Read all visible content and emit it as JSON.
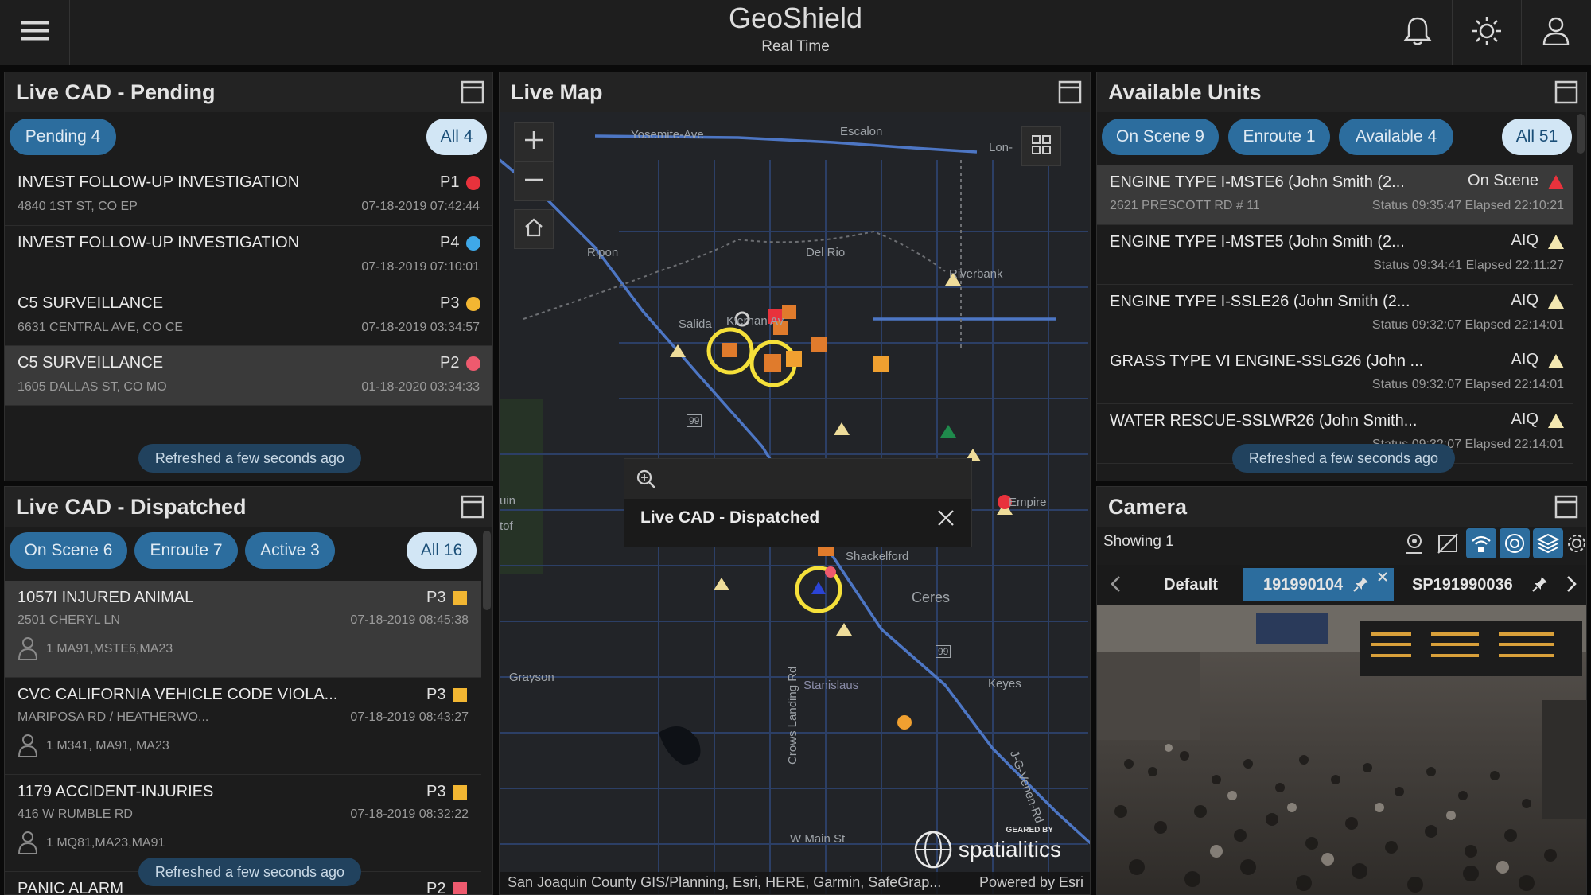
{
  "app": {
    "title": "GeoShield",
    "subtitle": "Real Time"
  },
  "icons": {
    "menu": "hamburger-menu-icon",
    "notifications": "bell-icon",
    "theme": "sun-icon",
    "user": "user-icon",
    "maximize": "window-maximize-icon"
  },
  "colors": {
    "accent": "#2c6d9e",
    "p1": "#e8323c",
    "p4": "#3fa8e8",
    "p3": "#f2b632",
    "p2": "#ee5a6e"
  },
  "pending": {
    "title": "Live CAD - Pending",
    "chips": [
      {
        "label": "Pending 4"
      }
    ],
    "all_label": "All 4",
    "rows": [
      {
        "title": "INVEST FOLLOW-UP INVESTIGATION",
        "address": "4840 1ST ST, CO EP",
        "priority": "P1",
        "datetime": "07-18-2019 07:42:44"
      },
      {
        "title": "INVEST FOLLOW-UP INVESTIGATION",
        "address": "",
        "priority": "P4",
        "datetime": "07-18-2019 07:10:01"
      },
      {
        "title": "C5 SURVEILLANCE",
        "address": "6631 CENTRAL AVE, CO CE",
        "priority": "P3",
        "datetime": "07-18-2019 03:34:57"
      },
      {
        "title": "C5 SURVEILLANCE",
        "address": "1605 DALLAS ST, CO MO",
        "priority": "P2",
        "datetime": "01-18-2020 03:34:33"
      }
    ],
    "refresh": "Refreshed a few seconds ago"
  },
  "dispatched": {
    "title": "Live CAD - Dispatched",
    "chips": [
      {
        "label": "On Scene 6"
      },
      {
        "label": "Enroute 7"
      },
      {
        "label": "Active 3"
      }
    ],
    "all_label": "All 16",
    "rows": [
      {
        "title": "1057I INJURED ANIMAL",
        "address": "2501 CHERYL LN",
        "priority": "P3",
        "datetime": "07-18-2019 08:45:38",
        "units": "1 MA91,MSTE6,MA23"
      },
      {
        "title": "CVC CALIFORNIA VEHICLE CODE VIOLA...",
        "address": "MARIPOSA RD / HEATHERWO...",
        "priority": "P3",
        "datetime": "07-18-2019 08:43:27",
        "units": "1 M341, MA91, MA23"
      },
      {
        "title": "1179 ACCIDENT-INJURIES",
        "address": "416 W RUMBLE RD",
        "priority": "P3",
        "datetime": "07-18-2019 08:32:22",
        "units": "1 MQ81,MA23,MA91"
      },
      {
        "title": "PANIC ALARM",
        "address": "",
        "priority": "P2",
        "datetime": "",
        "units": ""
      }
    ],
    "refresh": "Refreshed a few seconds ago"
  },
  "map": {
    "title": "Live Map",
    "labels": {
      "yosemite": "Yosemite-Ave",
      "escalon": "Escalon",
      "lon": "Lon-",
      "ripon": "Ripon",
      "delrio": "Del Rio",
      "riverbank": "Riverbank",
      "salida": "Salida",
      "kiernan": "Kiernan Av",
      "empire": "Empire",
      "shackelford": "Shackelford",
      "ceres": "Ceres",
      "grayson": "Grayson",
      "stanislaus": "Stanislaus",
      "keyes": "Keyes",
      "crows": "Crows Landing Rd",
      "wmain": "W Main St",
      "jgv": "J-G-Venen-Rd",
      "hwy99a": "99",
      "hwy99b": "99",
      "tuin": "uin",
      "tof": "tof"
    },
    "popup_title": "Live CAD - Dispatched",
    "attribution": "San Joaquin County GIS/Planning, Esri, HERE, Garmin, SafeGrap...",
    "powered": "Powered by Esri",
    "brand_geared": "GEARED BY",
    "brand_name": "spatialitics"
  },
  "units": {
    "title": "Available Units",
    "chips": [
      {
        "label": "On Scene 9"
      },
      {
        "label": "Enroute 1"
      },
      {
        "label": "Available 4"
      }
    ],
    "all_label": "All 51",
    "rows": [
      {
        "name": "ENGINE TYPE I-MSTE6 (John Smith (2...",
        "status": "On Scene",
        "address": "2621 PRESCOTT RD # 11",
        "times": "Status 09:35:47 Elapsed 22:10:21"
      },
      {
        "name": "ENGINE TYPE I-MSTE5 (John Smith (2...",
        "status": "AIQ",
        "address": "",
        "times": "Status 09:34:41 Elapsed 22:11:27"
      },
      {
        "name": "ENGINE TYPE I-SSLE26 (John Smith (2...",
        "status": "AIQ",
        "address": "",
        "times": "Status 09:32:07 Elapsed 22:14:01"
      },
      {
        "name": "GRASS TYPE VI ENGINE-SSLG26 (John ...",
        "status": "AIQ",
        "address": "",
        "times": "Status 09:32:07 Elapsed 22:14:01"
      },
      {
        "name": "WATER RESCUE-SSLWR26 (John Smith...",
        "status": "AIQ",
        "address": "",
        "times": "Status 09:32:07 Elapsed 22:14:01"
      }
    ],
    "refresh": "Refreshed a few seconds ago"
  },
  "camera": {
    "title": "Camera",
    "showing": "Showing 1",
    "tabs": [
      {
        "label": "Default"
      },
      {
        "label": "191990104"
      },
      {
        "label": "SP191990036"
      }
    ]
  }
}
